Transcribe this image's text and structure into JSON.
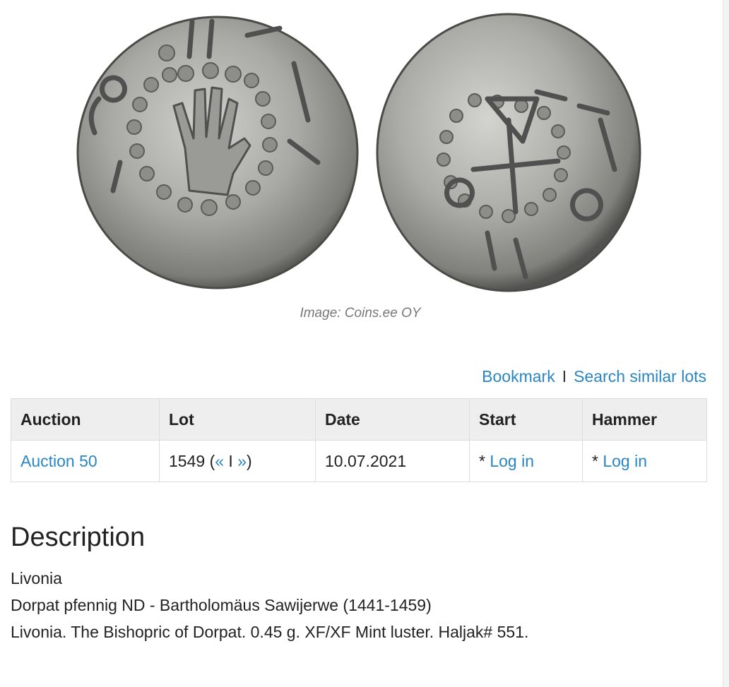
{
  "image": {
    "caption": "Image: Coins.ee OY",
    "obverse_icon": "coin-obverse-hand",
    "reverse_icon": "coin-reverse-cross"
  },
  "actions": {
    "bookmark": "Bookmark",
    "separator": "I",
    "search_similar": "Search similar lots"
  },
  "table": {
    "headers": [
      "Auction",
      "Lot",
      "Date",
      "Start",
      "Hammer"
    ],
    "row": {
      "auction": "Auction 50",
      "lot_number": "1549",
      "lot_open": "(",
      "prev": "«",
      "lot_sep": "I",
      "next": "»",
      "lot_close": ")",
      "date": "10.07.2021",
      "start_prefix": "* ",
      "start_link": "Log in",
      "hammer_prefix": "* ",
      "hammer_link": "Log in"
    }
  },
  "description": {
    "title": "Description",
    "lines": [
      "Livonia",
      "Dorpat pfennig ND - Bartholomäus Sawijerwe (1441-1459)",
      "Livonia. The Bishopric of Dorpat. 0.45 g. XF/XF Mint luster. Haljak# 551."
    ]
  },
  "colors": {
    "link": "#2a86c2",
    "coin_silver": "#a9a9a6",
    "coin_dark": "#5c5c59",
    "header_bg": "#eeeeee"
  }
}
